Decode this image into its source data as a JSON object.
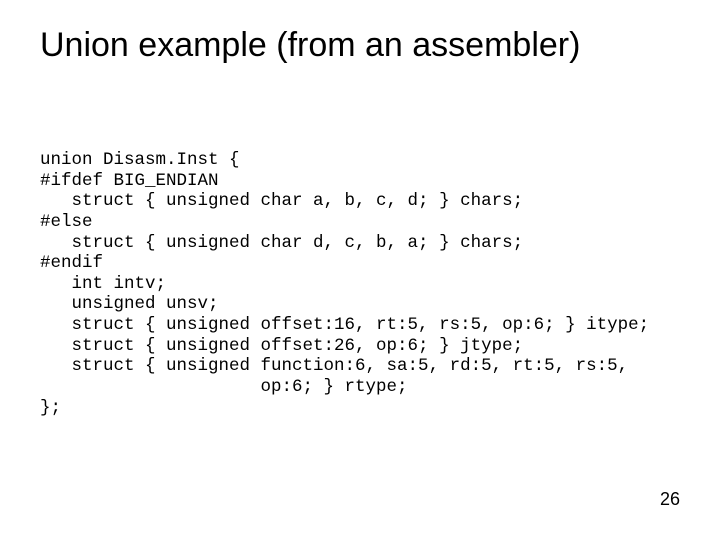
{
  "slide": {
    "title": "Union example (from an assembler)",
    "page_number": "26",
    "code_lines": {
      "l0": "union Disasm.Inst {",
      "l1": "#ifdef BIG_ENDIAN",
      "l2": "   struct { unsigned char a, b, c, d; } chars;",
      "l3": "#else",
      "l4": "   struct { unsigned char d, c, b, a; } chars;",
      "l5": "#endif",
      "l6": "   int intv;",
      "l7": "   unsigned unsv;",
      "l8": "   struct { unsigned offset:16, rt:5, rs:5, op:6; } itype;",
      "l9": "   struct { unsigned offset:26, op:6; } jtype;",
      "l10": "   struct { unsigned function:6, sa:5, rd:5, rt:5, rs:5,",
      "l11": "                     op:6; } rtype;",
      "l12": "};"
    }
  }
}
